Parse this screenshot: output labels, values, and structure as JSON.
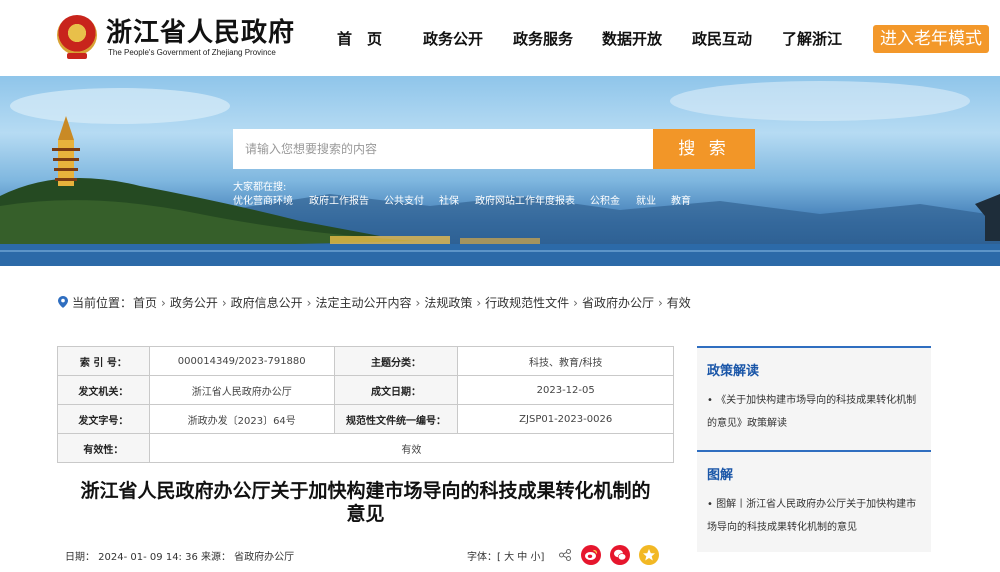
{
  "header": {
    "title": "浙江省人民政府",
    "subtitle": "The People's Government of Zhejiang Province",
    "nav": [
      "首　页",
      "政务公开",
      "政务服务",
      "数据开放",
      "政民互动",
      "了解浙江"
    ],
    "elder_mode_label": "进入老年模式"
  },
  "banner": {
    "search_placeholder": "请输入您想要搜索的内容",
    "search_button": "搜 索",
    "hot_label": "大家都在搜:",
    "hot_items": [
      "优化营商环境",
      "政府工作报告",
      "公共支付",
      "社保",
      "政府网站工作年度报表",
      "公积金",
      "就业",
      "教育"
    ]
  },
  "breadcrumb": {
    "lead": "当前位置：",
    "items": [
      "首页",
      "政务公开",
      "政府信息公开",
      "法定主动公开内容",
      "法规政策",
      "行政规范性文件",
      "省政府办公厅",
      "有效"
    ],
    "separator": "›"
  },
  "info_table": {
    "rows": [
      {
        "k1": "索 引 号：",
        "v1": "000014349/2023-791880",
        "k2": "主题分类：",
        "v2": "科技、教育/科技"
      },
      {
        "k1": "发文机关：",
        "v1": "浙江省人民政府办公厅",
        "k2": "成文日期：",
        "v2": "2023-12-05"
      },
      {
        "k1": "发文字号：",
        "v1": "浙政办发〔2023〕64号",
        "k2": "规范性文件统一编号：",
        "v2": "ZJSP01-2023-0026"
      }
    ],
    "validity_key": "有效性：",
    "validity_value": "有效"
  },
  "document": {
    "title_line1": "浙江省人民政府办公厅关于加快构建市场导向的科技成果转化机制的",
    "title_line2": "意见",
    "meta": "日期：  2024- 01- 09 14: 36   来源：  省政府办公厅",
    "font_label": "字体：",
    "font_open": "[",
    "font_large": "大",
    "font_medium": "中",
    "font_small": "小",
    "font_close": "]"
  },
  "sidebar": {
    "policy_heading": "政策解读",
    "policy_item": "•  《关于加快构建市场导向的科技成果转化机制的意见》政策解读",
    "graphic_heading": "图解",
    "graphic_item": "•  图解丨浙江省人民政府办公厅关于加快构建市场导向的科技成果转化机制的意见"
  },
  "colors": {
    "accent_orange": "#f29628",
    "link_blue": "#1a56a8",
    "weibo_red": "#e6162d",
    "qzone_yellow": "#f2b824"
  },
  "icons": [
    "emblem-icon",
    "pin-icon",
    "share-icon",
    "weibo-icon",
    "wechat-icon",
    "qzone-icon"
  ]
}
